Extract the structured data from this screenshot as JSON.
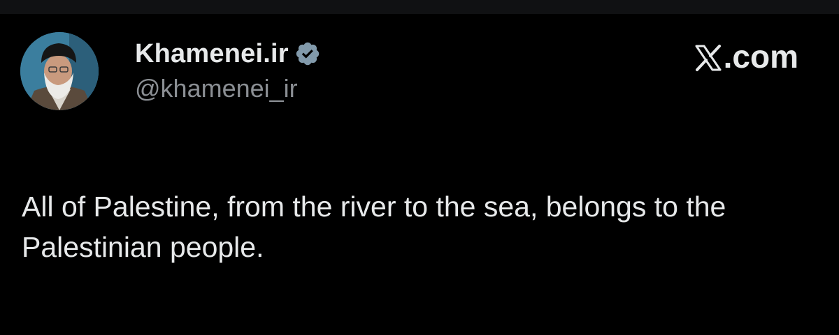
{
  "post": {
    "display_name": "Khamenei.ir",
    "handle": "@khamenei_ir",
    "site_label": ".com",
    "text": "All of Palestine, from the river to the sea, belongs to the Palestinian people."
  },
  "icons": {
    "verified": "verified-badge-icon",
    "site": "x-logo-icon"
  },
  "colors": {
    "background": "#000000",
    "text_primary": "#e7e9ea",
    "text_secondary": "#8b8f94",
    "verified_badge": "#829aab"
  }
}
